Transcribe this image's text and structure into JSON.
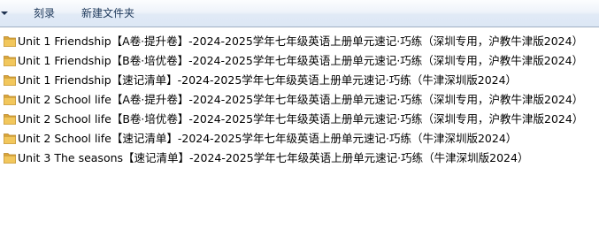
{
  "toolbar": {
    "burn_label": "刻录",
    "new_folder_label": "新建文件夹"
  },
  "icons": {
    "dropdown": "chevron-down-icon",
    "folder": "folder-icon"
  },
  "colors": {
    "folder": "#e8b848",
    "toolbar_text": "#1e395b"
  },
  "files": [
    {
      "name": "Unit 1 Friendship【A卷·提升卷】-2024-2025学年七年级英语上册单元速记·巧练（深圳专用，沪教牛津版2024）"
    },
    {
      "name": "Unit 1 Friendship【B卷·培优卷】-2024-2025学年七年级英语上册单元速记·巧练（深圳专用，沪教牛津版2024）"
    },
    {
      "name": "Unit 1 Friendship【速记清单】-2024-2025学年七年级英语上册单元速记·巧练（牛津深圳版2024）"
    },
    {
      "name": "Unit 2 School life【A卷·提升卷】-2024-2025学年七年级英语上册单元速记·巧练（深圳专用，沪教牛津版2024）"
    },
    {
      "name": "Unit 2 School life【B卷·培优卷】-2024-2025学年七年级英语上册单元速记·巧练（深圳专用，沪教牛津版2024）"
    },
    {
      "name": "Unit 2 School life【速记清单】-2024-2025学年七年级英语上册单元速记·巧练（牛津深圳版2024）"
    },
    {
      "name": "Unit 3 The seasons【速记清单】-2024-2025学年七年级英语上册单元速记·巧练（牛津深圳版2024）"
    }
  ]
}
